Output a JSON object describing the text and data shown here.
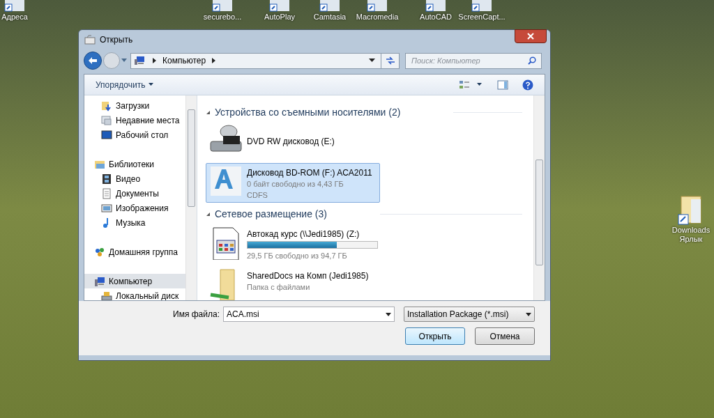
{
  "desktop_icons": [
    {
      "label": "Адреса"
    },
    {
      "label": "securebo..."
    },
    {
      "label": "AutoPlay"
    },
    {
      "label": "Camtasia"
    },
    {
      "label": "Macromedia"
    },
    {
      "label": "AutoCAD"
    },
    {
      "label": "ScreenCapt..."
    }
  ],
  "desktop_shortcut": {
    "lines": [
      "Downloads",
      "Ярлык"
    ]
  },
  "dialog": {
    "title": "Открыть",
    "address": {
      "crumbs": [
        "Компьютер"
      ]
    },
    "search": {
      "placeholder": "Поиск: Компьютер"
    },
    "toolbar": {
      "organize": "Упорядочить"
    },
    "nav_pane": {
      "tree": [
        {
          "children": [
            {
              "label": "Загрузки",
              "kind": "downloads",
              "selected": false
            },
            {
              "label": "Недавние места",
              "kind": "recent",
              "selected": false
            },
            {
              "label": "Рабочий стол",
              "kind": "desktop",
              "selected": false
            }
          ]
        },
        {
          "label": "Библиотеки",
          "kind": "libraries",
          "selected": false,
          "children": [
            {
              "label": "Видео",
              "kind": "video",
              "selected": false
            },
            {
              "label": "Документы",
              "kind": "documents",
              "selected": false
            },
            {
              "label": "Изображения",
              "kind": "pictures",
              "selected": false
            },
            {
              "label": "Музыка",
              "kind": "music",
              "selected": false
            }
          ]
        },
        {
          "label": "Домашняя группа",
          "kind": "homegroup",
          "selected": false
        },
        {
          "label": "Компьютер",
          "kind": "computer",
          "selected": true,
          "children": [
            {
              "label": "Локальный диск",
              "kind": "disk",
              "selected": false
            }
          ]
        }
      ]
    },
    "groups": [
      {
        "title": "Устройства со съемными носителями (2)",
        "expanded": true,
        "items": [
          {
            "kind": "dvd",
            "name": "DVD RW дисковод (E:)",
            "selected": false
          },
          {
            "kind": "bd",
            "name": "Дисковод BD-ROM (F:) ACA2011",
            "details": [
              "0 байт свободно из 4,43 ГБ",
              "CDFS"
            ],
            "selected": true
          }
        ]
      },
      {
        "title": "Сетевое размещение (3)",
        "expanded": true,
        "items": [
          {
            "kind": "network_drive",
            "name": "Автокад курс (\\\\Jedi1985) (Z:)",
            "level": 0.69,
            "details": [
              "29,5 ГБ свободно из 94,7 ГБ"
            ],
            "selected": false
          },
          {
            "kind": "shared_folder",
            "name": "SharedDocs на Комп (Jedi1985)",
            "details": [
              "Папка с файлами"
            ],
            "selected": false
          }
        ]
      }
    ],
    "filename_label": "Имя файла:",
    "filename": "ACA.msi",
    "filter": "Installation Package (*.msi)",
    "buttons": [
      {
        "label": "Открыть",
        "default": true
      },
      {
        "label": "Отмена",
        "default": false
      }
    ]
  }
}
